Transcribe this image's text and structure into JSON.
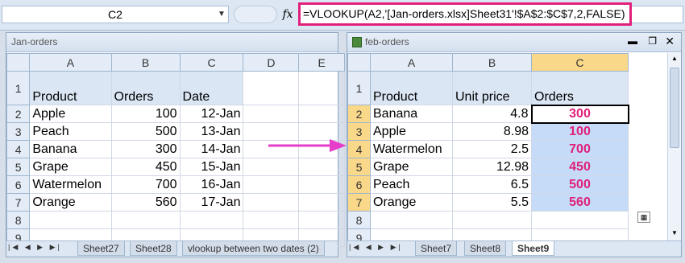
{
  "formula_bar": {
    "cell_ref": "C2",
    "fx": "fx",
    "formula": "=VLOOKUP(A2,'[Jan-orders.xlsx]Sheet31'!$A$2:$C$7,2,FALSE)"
  },
  "left_window": {
    "title": "Jan-orders",
    "columns": [
      "A",
      "B",
      "C",
      "D",
      "E"
    ],
    "rows": [
      {
        "n": "1",
        "a": "Product",
        "b": "Orders",
        "c": "Date"
      },
      {
        "n": "2",
        "a": "Apple",
        "b": "100",
        "c": "12-Jan"
      },
      {
        "n": "3",
        "a": "Peach",
        "b": "500",
        "c": "13-Jan"
      },
      {
        "n": "4",
        "a": "Banana",
        "b": "300",
        "c": "14-Jan"
      },
      {
        "n": "5",
        "a": "Grape",
        "b": "450",
        "c": "15-Jan"
      },
      {
        "n": "6",
        "a": "Watermelon",
        "b": "700",
        "c": "16-Jan"
      },
      {
        "n": "7",
        "a": "Orange",
        "b": "560",
        "c": "17-Jan"
      },
      {
        "n": "8",
        "a": "",
        "b": "",
        "c": ""
      },
      {
        "n": "9",
        "a": "",
        "b": "",
        "c": ""
      }
    ],
    "tabs": [
      "Sheet27",
      "Sheet28",
      "vlookup between two dates (2)"
    ]
  },
  "right_window": {
    "title": "feb-orders",
    "columns": [
      "A",
      "B",
      "C"
    ],
    "rows": [
      {
        "n": "1",
        "a": "Product",
        "b": "Unit price",
        "c": "Orders"
      },
      {
        "n": "2",
        "a": "Banana",
        "b": "4.8",
        "c": "300"
      },
      {
        "n": "3",
        "a": "Apple",
        "b": "8.98",
        "c": "100"
      },
      {
        "n": "4",
        "a": "Watermelon",
        "b": "2.5",
        "c": "700"
      },
      {
        "n": "5",
        "a": "Grape",
        "b": "12.98",
        "c": "450"
      },
      {
        "n": "6",
        "a": "Peach",
        "b": "6.5",
        "c": "500"
      },
      {
        "n": "7",
        "a": "Orange",
        "b": "5.5",
        "c": "560"
      },
      {
        "n": "8",
        "a": "",
        "b": "",
        "c": ""
      },
      {
        "n": "9",
        "a": "",
        "b": "",
        "c": ""
      }
    ],
    "tabs": [
      "Sheet7",
      "Sheet8",
      "Sheet9"
    ],
    "active_tab": "Sheet9"
  },
  "colors": {
    "accent": "#e0207a",
    "selection": "#c5dbf7",
    "header_selected": "#f9d88a"
  }
}
